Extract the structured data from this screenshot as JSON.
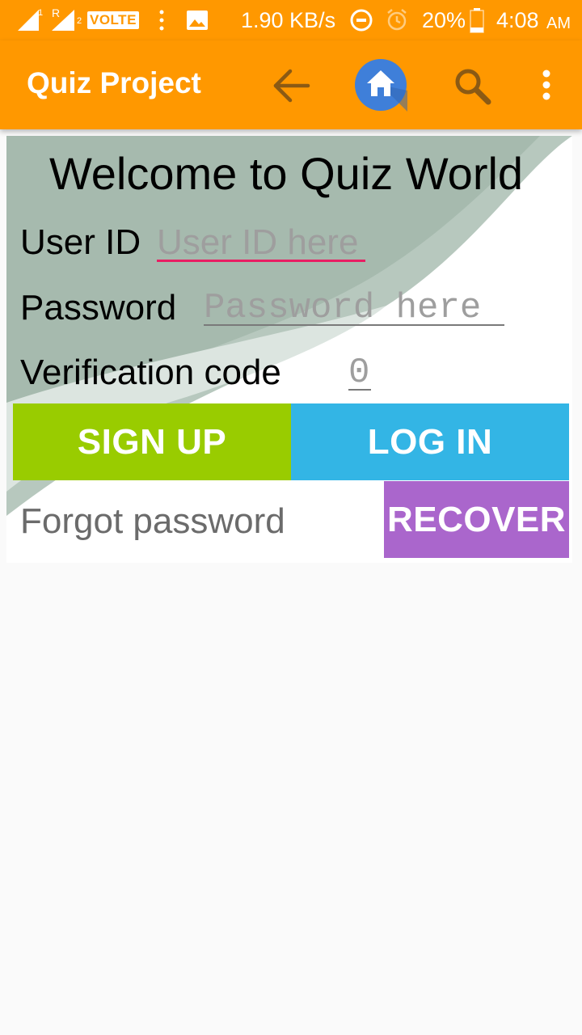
{
  "status_bar": {
    "sim1_label": "R",
    "volte": "VOLTE",
    "speed": "1.90 KB/s",
    "battery": "20%",
    "time": "4:08",
    "ampm": "AM"
  },
  "app_bar": {
    "title": "Quiz Project",
    "icons": [
      "back-arrow-icon",
      "home-icon",
      "search-icon",
      "overflow-menu-icon"
    ]
  },
  "login": {
    "welcome": "Welcome to Quiz World",
    "user_id_label": "User ID",
    "user_id_placeholder": "User ID here",
    "password_label": "Password",
    "password_placeholder": "Password here",
    "verification_label": "Verification code",
    "verification_value": "0",
    "sign_up": "SIGN UP",
    "log_in": "LOG IN",
    "forgot_label": "Forgot password",
    "recover": "RECOVER"
  },
  "colors": {
    "app_bar": "#FF9800",
    "sign_up": "#99CC00",
    "log_in": "#33B5E5",
    "recover": "#AA66CC",
    "focus_underline": "#E91E63"
  }
}
